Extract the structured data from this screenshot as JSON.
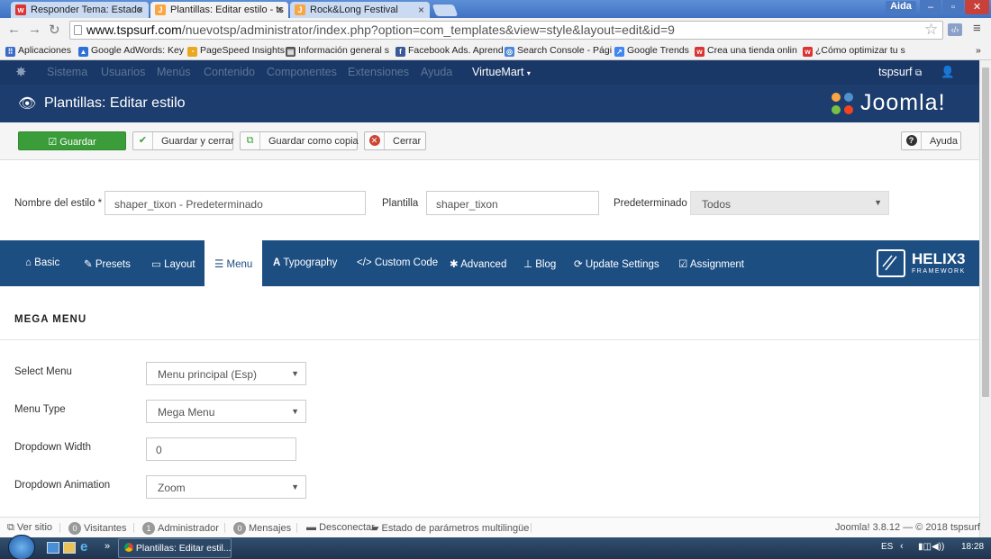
{
  "browser": {
    "tabs": [
      {
        "label": "Responder Tema: Estado",
        "icon": "wix-favicon"
      },
      {
        "label": "Plantillas: Editar estilo - ts",
        "icon": "joomla-favicon"
      },
      {
        "label": "Rock&Long Festival",
        "icon": "joomla-favicon"
      }
    ],
    "window_user": "Aida",
    "url_domain": "www.tspsurf.com",
    "url_path": "/nuevotsp/administrator/index.php?option=com_templates&view=style&layout=edit&id=9",
    "bookmarks": [
      "Aplicaciones",
      "Google AdWords: Key",
      "PageSpeed Insights",
      "Información general s",
      "Facebook Ads. Aprend",
      "Search Console - Pági",
      "Google Trends",
      "Crea una tienda onlin",
      "¿Cómo optimizar tu s"
    ],
    "bookmarks_more": "»"
  },
  "nav": {
    "menu": [
      "Sistema",
      "Usuarios",
      "Menús",
      "Contenido",
      "Componentes",
      "Extensiones",
      "Ayuda",
      "VirtueMart"
    ],
    "user": "tspsurf"
  },
  "header": {
    "title": "Plantillas: Editar estilo",
    "logo": "Joomla!"
  },
  "toolbar": {
    "save": "Guardar",
    "save_close": "Guardar y cerrar",
    "save_copy": "Guardar como copia",
    "close": "Cerrar",
    "help": "Ayuda"
  },
  "style_form": {
    "name_label": "Nombre del estilo *",
    "name_value": "shaper_tixon - Predeterminado",
    "template_label": "Plantilla",
    "template_value": "shaper_tixon",
    "default_label": "Predeterminado",
    "default_value": "Todos"
  },
  "helix": {
    "tabs": [
      "Basic",
      "Presets",
      "Layout",
      "Menu",
      "Typography",
      "Custom Code",
      "Advanced",
      "Blog",
      "Update Settings",
      "Assignment"
    ],
    "active_tab": "Menu",
    "brand": "HELIX3",
    "brand_sub": "FRAMEWORK"
  },
  "mega_menu": {
    "section_title": "MEGA MENU",
    "fields": [
      {
        "label": "Select Menu",
        "value": "Menu principal (Esp)"
      },
      {
        "label": "Menu Type",
        "value": "Mega Menu"
      },
      {
        "label": "Dropdown Width",
        "value": "0"
      },
      {
        "label": "Dropdown Animation",
        "value": "Zoom"
      }
    ]
  },
  "status": {
    "view_site": "Ver sitio",
    "visitors_count": "0",
    "visitors": "Visitantes",
    "admins_count": "1",
    "admins": "Administrador",
    "messages_count": "0",
    "messages": "Mensajes",
    "logout": "Desconectar",
    "multilang": "Estado de parámetros multilingüe",
    "version": "Joomla! 3.8.12 — © 2018 tspsurf"
  },
  "taskbar": {
    "active_window": "Plantillas: Editar estil...",
    "more": "»",
    "lang": "ES",
    "time": "18:28"
  },
  "colors": {
    "nav_bg": "#1a3867",
    "header_bg": "#1c3d6e",
    "helix_bg": "#1c4e82",
    "save_green": "#3a9d3a"
  }
}
